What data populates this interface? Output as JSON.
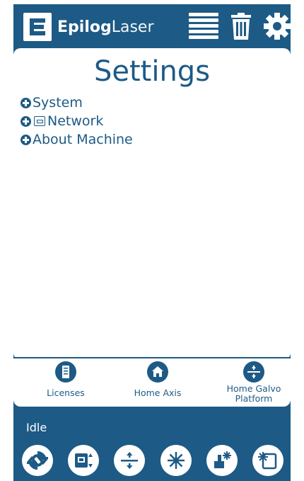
{
  "brand": {
    "bold": "Epilog",
    "light": "Laser"
  },
  "page_title": "Settings",
  "settings_items": [
    {
      "label": "System"
    },
    {
      "label": "Network"
    },
    {
      "label": "About Machine"
    }
  ],
  "tools": {
    "licenses": "Licenses",
    "home_axis": "Home Axis",
    "home_galvo": "Home Galvo Platform"
  },
  "status": "Idle",
  "colors": {
    "primary": "#1d5a86",
    "background": "#ffffff"
  },
  "icons": {
    "header": [
      "job-list-icon",
      "trash-icon",
      "gear-icon"
    ],
    "bottom_bar": [
      "refresh-icon",
      "job-transfer-icon",
      "jog-icon",
      "laser-icon",
      "focus-icon",
      "frame-icon"
    ]
  }
}
